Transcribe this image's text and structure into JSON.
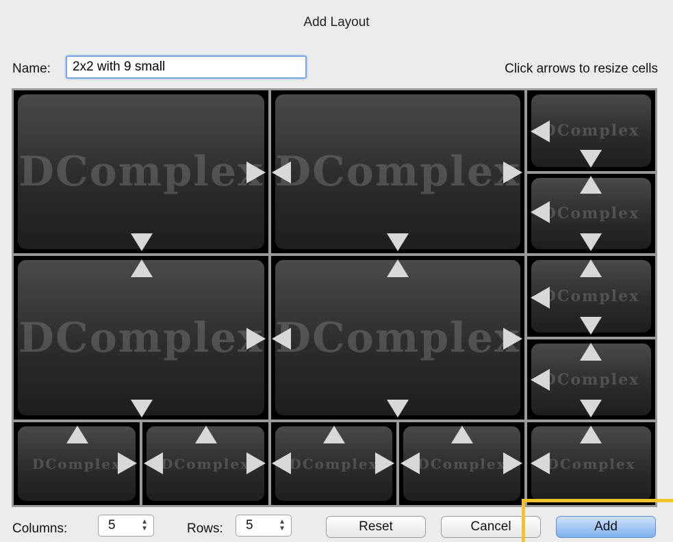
{
  "dialog": {
    "title": "Add Layout",
    "name_label": "Name:",
    "name_value": "2x2 with 9 small",
    "hint": "Click arrows to resize cells"
  },
  "grid": {
    "watermark_text": "DComplex",
    "columns": 5,
    "rows": 5
  },
  "footer": {
    "columns_label": "Columns:",
    "columns_value": "5",
    "rows_label": "Rows:",
    "rows_value": "5",
    "reset_label": "Reset",
    "cancel_label": "Cancel",
    "add_label": "Add"
  },
  "colors": {
    "highlight": "#f6c22b",
    "primary_button": "#7fb0ee"
  }
}
